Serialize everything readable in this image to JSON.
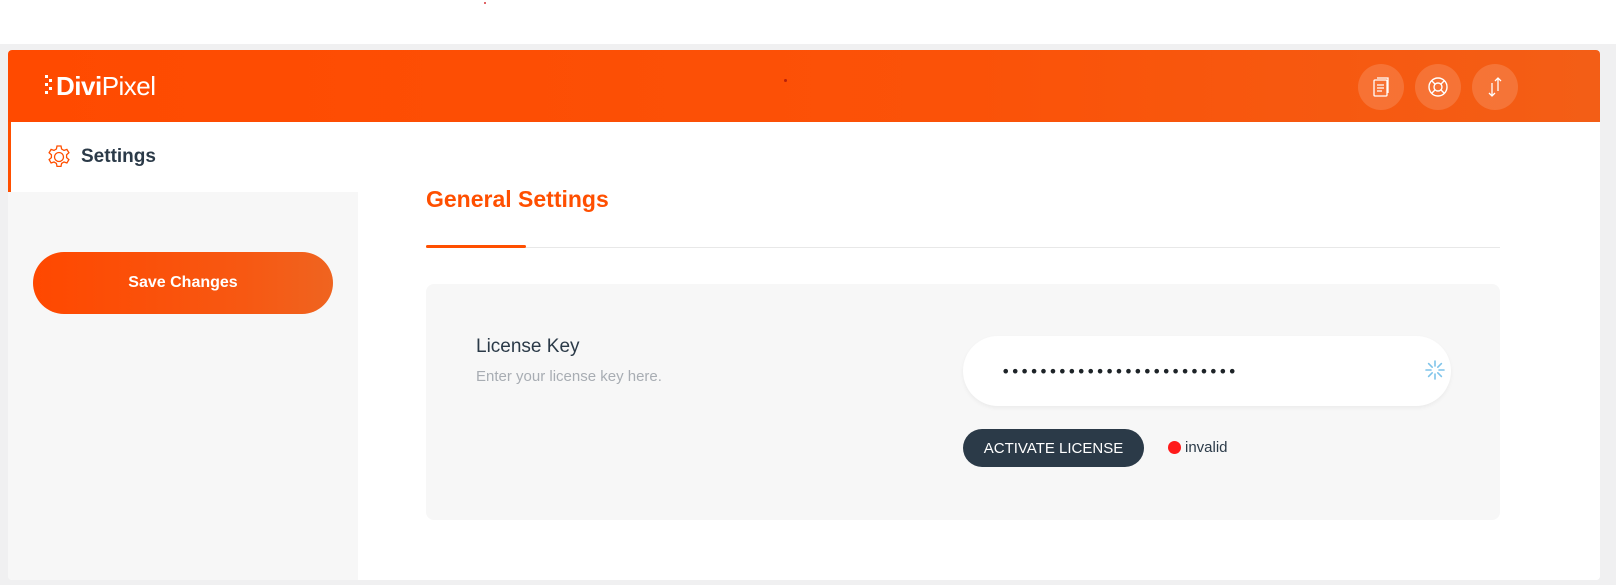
{
  "app": {
    "logo_bold": "Divi",
    "logo_light": "Pixel",
    "brand_color": "#ff4f00",
    "header_icons": [
      "document-icon",
      "lifebuoy-icon",
      "import-export-icon"
    ]
  },
  "sidebar": {
    "active_tab_label": "Settings",
    "active_tab_icon": "gear-icon",
    "save_label": "Save Changes"
  },
  "main": {
    "section_title": "General Settings",
    "license": {
      "label": "License Key",
      "description": "Enter your license key here.",
      "value": "•••••••••••••••••••••••••",
      "activate_label": "ACTIVATE LICENSE",
      "status_text": "invalid",
      "status_color": "#ff1a1a"
    }
  }
}
